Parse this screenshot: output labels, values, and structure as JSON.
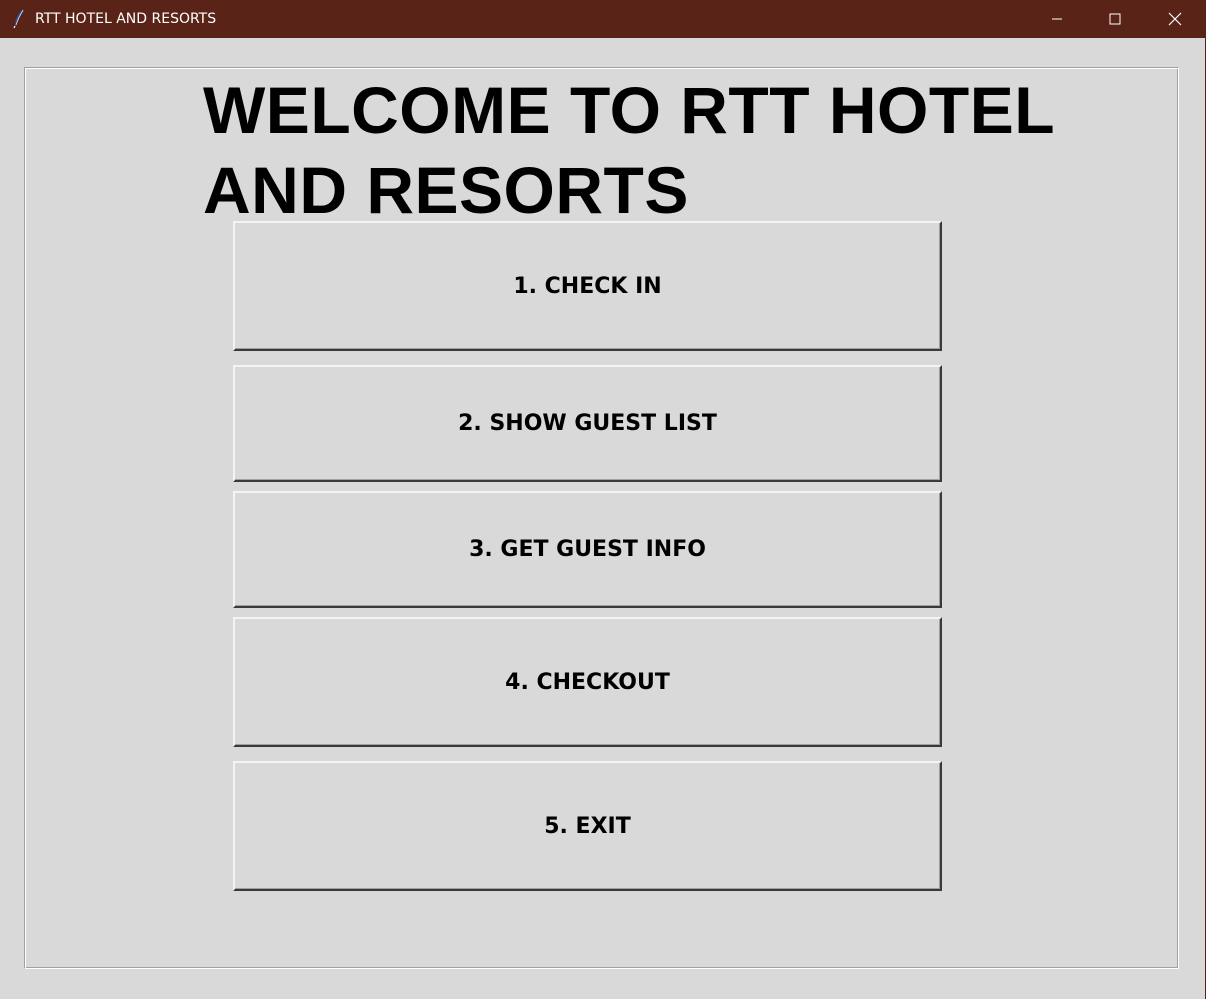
{
  "window": {
    "title": "RTT HOTEL AND RESORTS",
    "titlebar_color": "#5a2317",
    "background_color": "#d9d9d9",
    "controls": {
      "minimize_icon": "minimize-icon",
      "maximize_icon": "maximize-icon",
      "close_icon": "close-icon"
    }
  },
  "main": {
    "welcome_text": "WELCOME TO RTT HOTEL AND RESORTS",
    "buttons": [
      {
        "label": "1. CHECK IN"
      },
      {
        "label": "2. SHOW GUEST LIST"
      },
      {
        "label": "3. GET GUEST INFO"
      },
      {
        "label": "4. CHECKOUT"
      },
      {
        "label": "5. EXIT"
      }
    ]
  }
}
